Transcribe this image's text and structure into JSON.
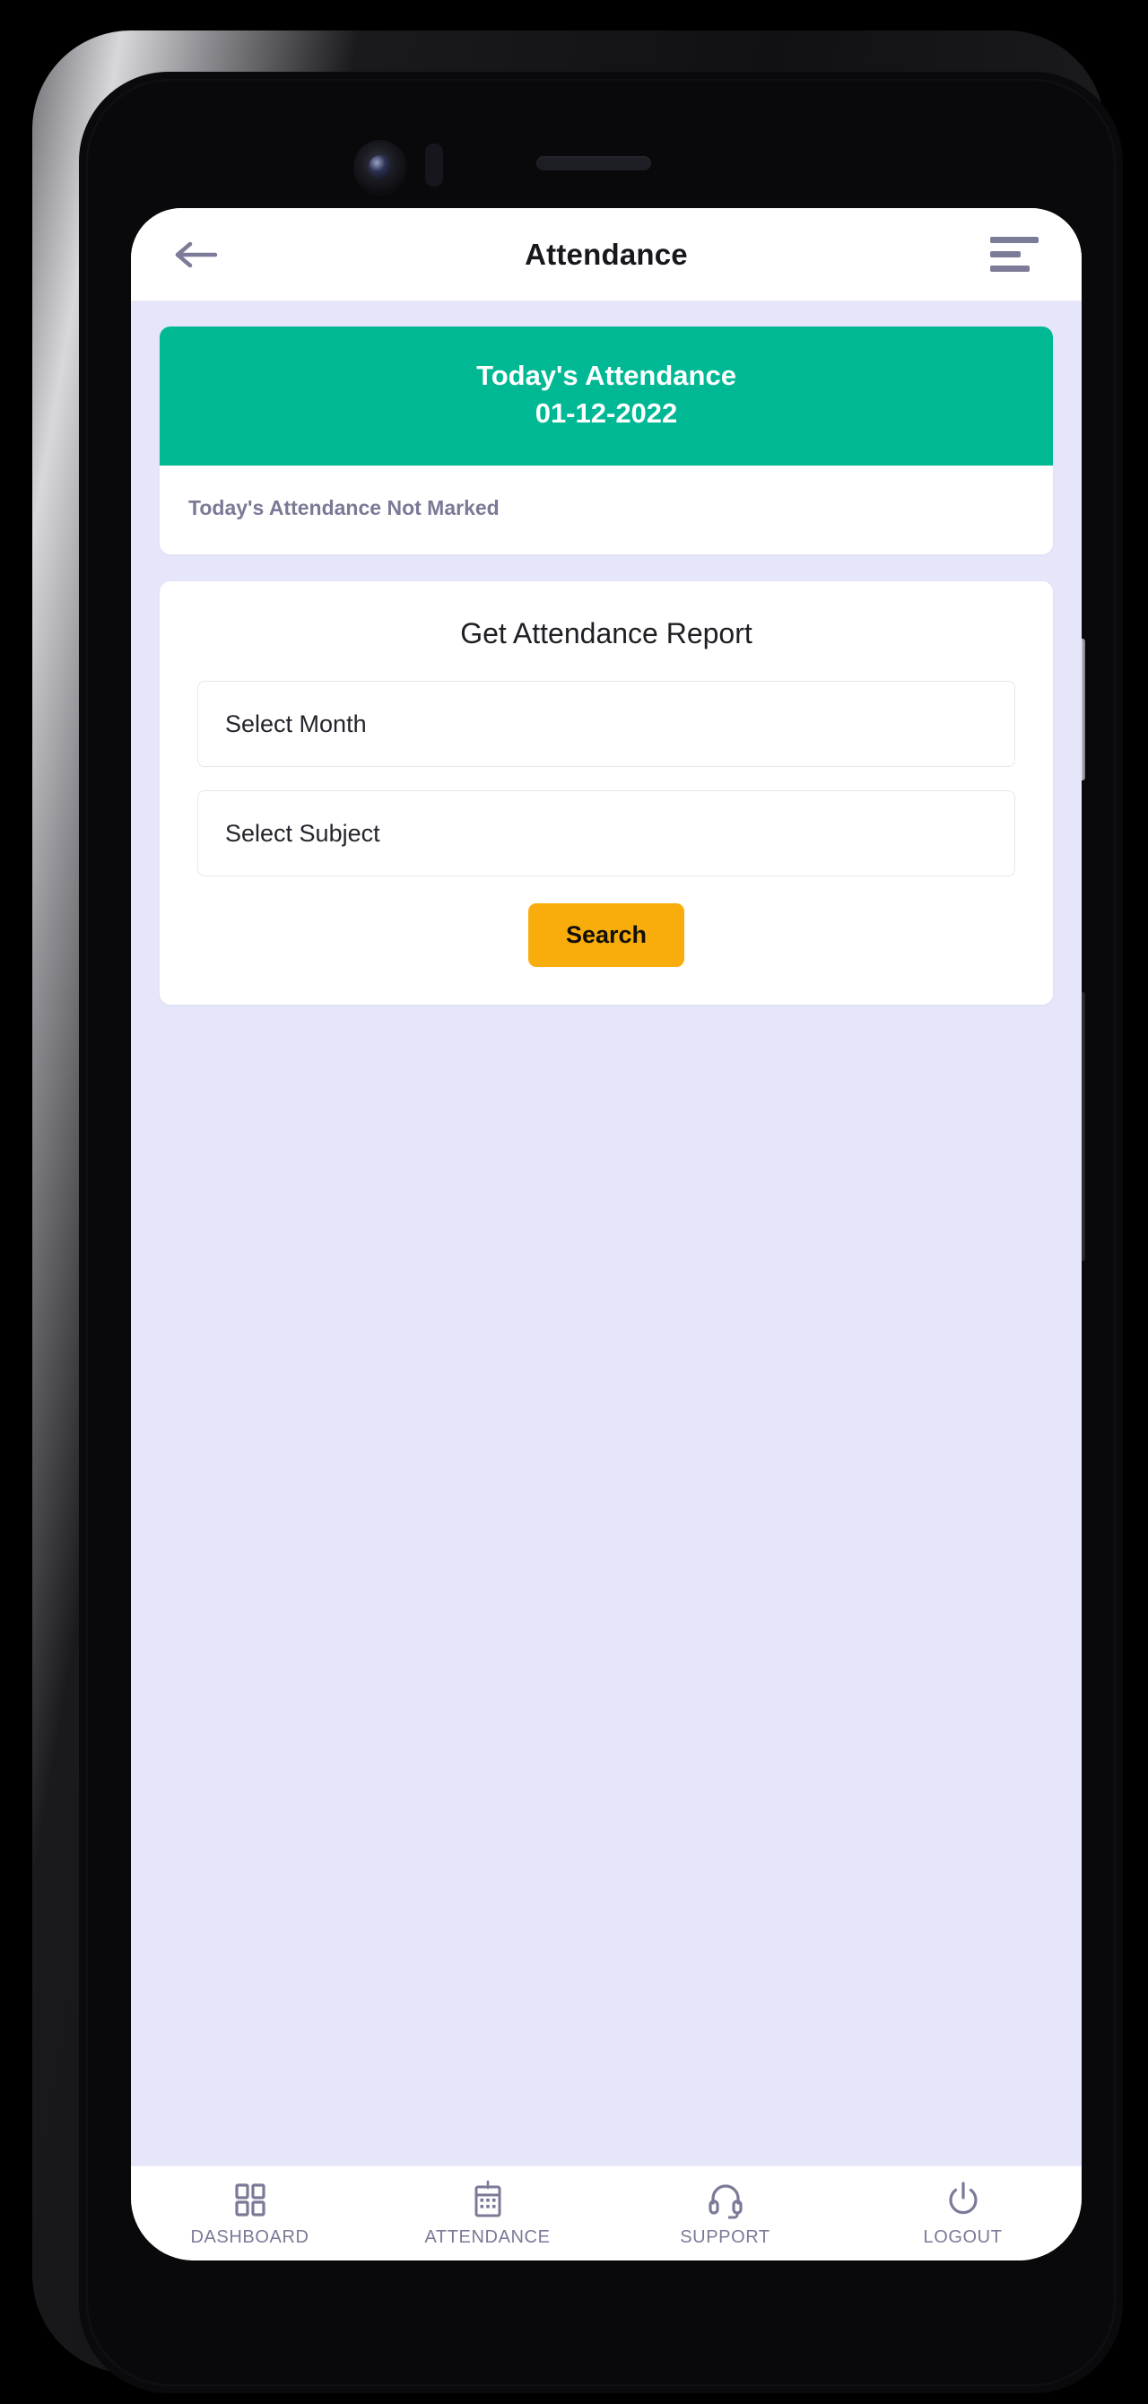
{
  "appbar": {
    "title": "Attendance",
    "back_icon": "arrow-left-icon",
    "menu_icon": "hamburger-menu-icon"
  },
  "today_card": {
    "heading_line1": "Today's Attendance",
    "heading_line2": "01-12-2022",
    "status_text": "Today's Attendance Not Marked",
    "header_color": "#00b894"
  },
  "report_card": {
    "title": "Get Attendance Report",
    "month_select": {
      "value": "Select Month",
      "placeholder": "Select Month"
    },
    "subject_select": {
      "value": "Select Subject",
      "placeholder": "Select Subject"
    },
    "search_button": "Search",
    "search_button_color": "#f9ad0d"
  },
  "bottom_nav": {
    "items": [
      {
        "label": "DASHBOARD",
        "icon": "grid-icon"
      },
      {
        "label": "ATTENDANCE",
        "icon": "calendar-icon"
      },
      {
        "label": "SUPPORT",
        "icon": "headset-icon"
      },
      {
        "label": "LOGOUT",
        "icon": "power-icon"
      }
    ],
    "color": "#7a7a98"
  },
  "theme": {
    "page_background": "#e6e6fb",
    "surface": "#ffffff",
    "accent_green": "#00b894",
    "accent_amber": "#f9ad0d",
    "muted_purple": "#7a7a98"
  }
}
